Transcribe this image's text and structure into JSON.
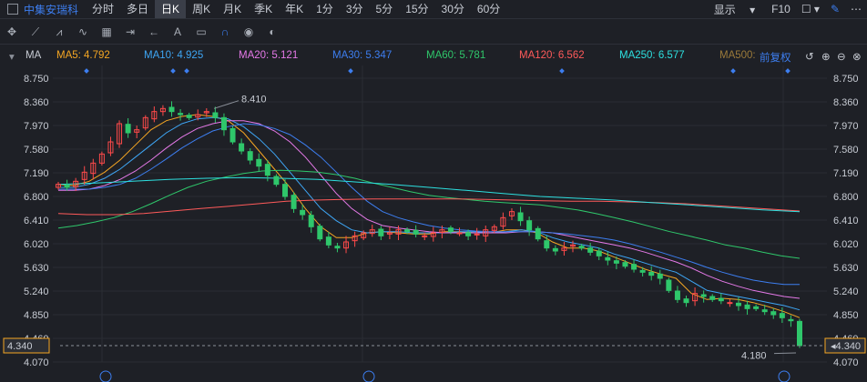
{
  "header": {
    "stock_name": "中集安瑞科",
    "periods": [
      "分时",
      "多日",
      "日K",
      "周K",
      "月K",
      "季K",
      "年K",
      "1分",
      "3分",
      "5分",
      "15分",
      "30分",
      "60分"
    ],
    "active_period": "日K",
    "display_label": "显示",
    "f10_label": "F10"
  },
  "toolbar": {
    "icons": [
      "crosshair-icon",
      "line-icon",
      "polyline-icon",
      "wave-icon",
      "rect-icon",
      "hline-icon",
      "arrow-icon",
      "text-icon",
      "comment-icon",
      "magnet-icon",
      "eye-icon",
      "toggle-icon"
    ]
  },
  "ma_bar": {
    "label": "MA",
    "adjust_label": "前复权",
    "items": [
      {
        "text": "MA5: 4.792",
        "color": "#f5a623"
      },
      {
        "text": "MA10: 4.925",
        "color": "#3ea6f5"
      },
      {
        "text": "MA20: 5.121",
        "color": "#e579e8"
      },
      {
        "text": "MA30: 5.347",
        "color": "#3d7ef0"
      },
      {
        "text": "MA60: 5.781",
        "color": "#2fc76b"
      },
      {
        "text": "MA120: 6.562",
        "color": "#ff5a5a"
      },
      {
        "text": "MA250: 6.577",
        "color": "#2de0e0"
      },
      {
        "text": "MA500:",
        "color": "#9b7a3a"
      }
    ]
  },
  "chart_data": {
    "type": "candlestick",
    "y_ticks": [
      "8.750",
      "8.360",
      "7.970",
      "7.580",
      "7.190",
      "6.800",
      "6.410",
      "6.020",
      "5.630",
      "5.240",
      "4.850",
      "4.460",
      "4.070"
    ],
    "ylim": [
      4.07,
      8.75
    ],
    "current_price": "4.340",
    "high_label": "8.410",
    "low_label": "4.180",
    "up_color": "#ff4a4a",
    "down_color": "#2fc76b",
    "close_path": [
      7.0,
      6.95,
      7.05,
      7.2,
      7.35,
      7.5,
      7.7,
      8.0,
      7.85,
      7.9,
      8.1,
      8.2,
      8.25,
      8.2,
      8.15,
      8.1,
      8.15,
      8.2,
      8.1,
      7.9,
      7.7,
      7.55,
      7.4,
      7.3,
      7.15,
      7.0,
      6.8,
      6.6,
      6.5,
      6.3,
      6.1,
      6.0,
      5.95,
      6.05,
      6.15,
      6.2,
      6.25,
      6.15,
      6.2,
      6.25,
      6.22,
      6.18,
      6.15,
      6.2,
      6.25,
      6.22,
      6.2,
      6.15,
      6.18,
      6.25,
      6.3,
      6.45,
      6.55,
      6.4,
      6.25,
      6.1,
      5.95,
      5.9,
      5.95,
      6.0,
      5.95,
      5.88,
      5.82,
      5.75,
      5.7,
      5.65,
      5.6,
      5.55,
      5.5,
      5.45,
      5.25,
      5.1,
      5.05,
      5.2,
      5.15,
      5.1,
      5.08,
      5.05,
      5.0,
      4.95,
      4.95,
      4.9,
      4.85,
      4.8,
      4.75,
      4.34
    ],
    "ma_series": [
      {
        "name": "MA5",
        "color": "#f5a623",
        "values": [
          7.0,
          6.98,
          7.05,
          7.2,
          7.4,
          7.65,
          7.9,
          8.05,
          8.12,
          8.15,
          8.12,
          8.05,
          7.85,
          7.55,
          7.25,
          6.95,
          6.6,
          6.3,
          6.12,
          6.12,
          6.2,
          6.22,
          6.2,
          6.18,
          6.18,
          6.22,
          6.22,
          6.2,
          6.2,
          6.25,
          6.25,
          6.2,
          6.05,
          5.95,
          5.95,
          5.9,
          5.8,
          5.7,
          5.6,
          5.52,
          5.45,
          5.2,
          5.1,
          5.12,
          5.1,
          5.05,
          4.98,
          4.9,
          4.8
        ]
      },
      {
        "name": "MA10",
        "color": "#3ea6f5",
        "values": [
          6.95,
          6.95,
          7.0,
          7.1,
          7.25,
          7.45,
          7.65,
          7.85,
          8.0,
          8.08,
          8.1,
          8.08,
          7.95,
          7.75,
          7.5,
          7.2,
          6.9,
          6.6,
          6.4,
          6.25,
          6.2,
          6.22,
          6.22,
          6.2,
          6.2,
          6.2,
          6.22,
          6.22,
          6.2,
          6.22,
          6.25,
          6.22,
          6.12,
          6.05,
          6.0,
          5.95,
          5.85,
          5.78,
          5.7,
          5.62,
          5.55,
          5.4,
          5.25,
          5.2,
          5.15,
          5.1,
          5.05,
          5.0,
          4.93
        ]
      },
      {
        "name": "MA20",
        "color": "#e579e8",
        "values": [
          6.9,
          6.9,
          6.92,
          6.98,
          7.08,
          7.22,
          7.4,
          7.6,
          7.78,
          7.92,
          8.0,
          8.05,
          8.05,
          8.0,
          7.88,
          7.7,
          7.45,
          7.15,
          6.85,
          6.6,
          6.42,
          6.32,
          6.28,
          6.25,
          6.22,
          6.2,
          6.2,
          6.2,
          6.2,
          6.2,
          6.22,
          6.22,
          6.2,
          6.15,
          6.1,
          6.05,
          6.0,
          5.95,
          5.88,
          5.8,
          5.72,
          5.62,
          5.5,
          5.4,
          5.32,
          5.25,
          5.2,
          5.15,
          5.12
        ]
      },
      {
        "name": "MA30",
        "color": "#3d7ef0",
        "values": [
          6.92,
          6.92,
          6.92,
          6.95,
          7.0,
          7.1,
          7.25,
          7.42,
          7.6,
          7.75,
          7.88,
          7.95,
          8.0,
          7.98,
          7.92,
          7.82,
          7.65,
          7.45,
          7.2,
          6.95,
          6.72,
          6.55,
          6.45,
          6.38,
          6.32,
          6.28,
          6.25,
          6.23,
          6.22,
          6.22,
          6.22,
          6.22,
          6.2,
          6.18,
          6.15,
          6.12,
          6.08,
          6.02,
          5.95,
          5.88,
          5.8,
          5.72,
          5.63,
          5.55,
          5.48,
          5.42,
          5.38,
          5.35,
          5.35
        ]
      },
      {
        "name": "MA60",
        "color": "#2fc76b",
        "values": [
          6.28,
          6.32,
          6.38,
          6.45,
          6.55,
          6.68,
          6.82,
          6.95,
          7.05,
          7.12,
          7.18,
          7.22,
          7.23,
          7.22,
          7.2,
          7.16,
          7.1,
          7.02,
          6.95,
          6.88,
          6.82,
          6.78,
          6.75,
          6.72,
          6.7,
          6.68,
          6.66,
          6.62,
          6.58,
          6.52,
          6.45,
          6.38,
          6.3,
          6.22,
          6.15,
          6.08,
          6.0,
          5.95,
          5.88,
          5.82,
          5.78
        ]
      },
      {
        "name": "MA120",
        "color": "#ff5a5a",
        "values": [
          6.52,
          6.5,
          6.5,
          6.52,
          6.56,
          6.6,
          6.64,
          6.68,
          6.72,
          6.74,
          6.75,
          6.76,
          6.76,
          6.76,
          6.76,
          6.75,
          6.74,
          6.73,
          6.72,
          6.72,
          6.71,
          6.7,
          6.68,
          6.65,
          6.62,
          6.59,
          6.56
        ]
      },
      {
        "name": "MA250",
        "color": "#2de0e0",
        "values": [
          7.0,
          7.02,
          7.05,
          7.08,
          7.1,
          7.11,
          7.1,
          7.08,
          7.04,
          7.0,
          6.95,
          6.9,
          6.85,
          6.8,
          6.77,
          6.74,
          6.7,
          6.66,
          6.62,
          6.58,
          6.55
        ]
      }
    ]
  }
}
